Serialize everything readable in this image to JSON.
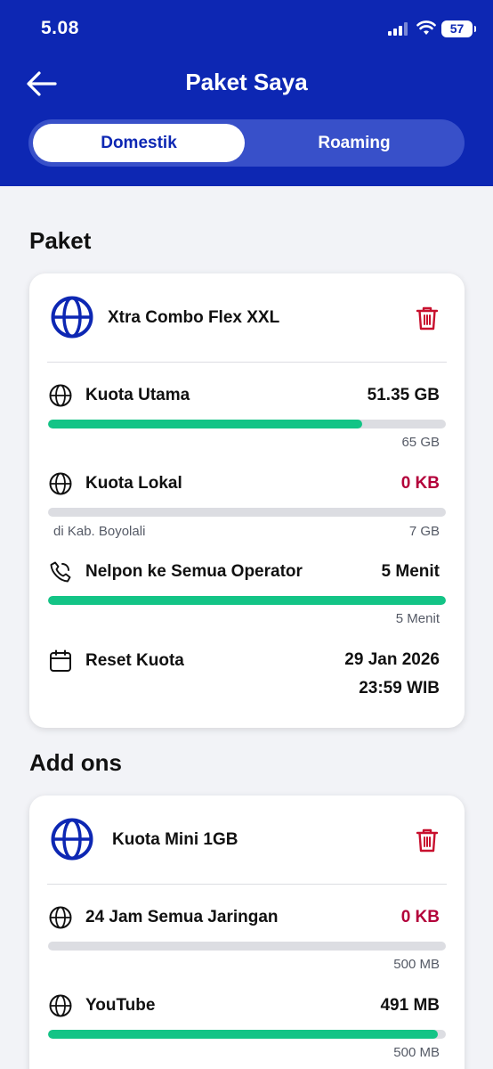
{
  "status_bar": {
    "time": "5.08",
    "battery": "57"
  },
  "header": {
    "title": "Paket Saya",
    "back_icon": "arrow-left-icon"
  },
  "tabs": [
    {
      "label": "Domestik",
      "active": true
    },
    {
      "label": "Roaming",
      "active": false
    }
  ],
  "paket": {
    "section_title": "Paket",
    "name": "Xtra Combo Flex XXL",
    "items": [
      {
        "icon": "globe-icon",
        "label": "Kuota Utama",
        "value": "51.35 GB",
        "total": "65 GB",
        "fraction": 0.79
      },
      {
        "icon": "globe-icon",
        "label": "Kuota Lokal",
        "value": "0 KB",
        "total": "7 GB",
        "note": "di Kab. Boyolali",
        "fraction": 0
      },
      {
        "icon": "phone-icon",
        "label": "Nelpon ke Semua Operator",
        "value": "5 Menit",
        "total": "5 Menit",
        "fraction": 1
      }
    ],
    "reset": {
      "icon": "calendar-icon",
      "label": "Reset Kuota",
      "date": "29 Jan 2026",
      "time": "23:59 WIB"
    }
  },
  "addons": {
    "section_title": "Add ons",
    "name": "Kuota Mini 1GB",
    "items": [
      {
        "icon": "globe-icon",
        "label": "24 Jam Semua Jaringan",
        "value": "0 KB",
        "total": "500 MB",
        "fraction": 0
      },
      {
        "icon": "globe-icon",
        "label": "YouTube",
        "value": "491 MB",
        "total": "500 MB",
        "fraction": 0.98
      }
    ]
  },
  "colors": {
    "header": "#0d27b3",
    "bar_fill": "#13c486",
    "bar_track": "#dcdde2",
    "zero_value": "#b3003a",
    "trash": "#c8102e"
  }
}
